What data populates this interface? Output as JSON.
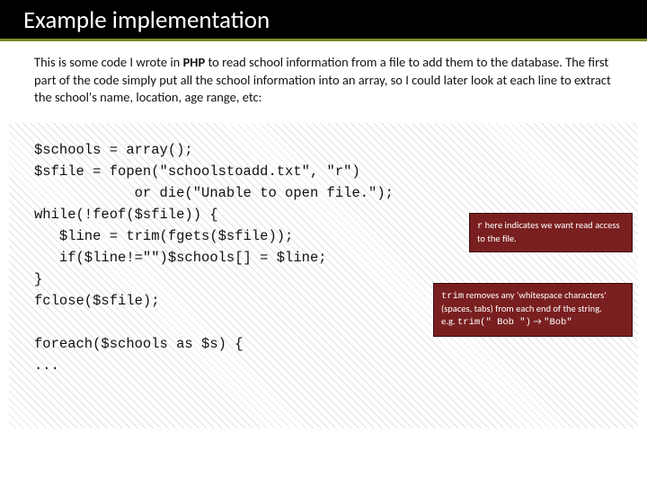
{
  "title": "Example implementation",
  "intro_parts": {
    "before": "This is some code I wrote in ",
    "bold": "PHP",
    "after": " to read school information from a file to add them to the database. The first part of the code simply put all the school information into an array, so I could later look at each line to extract the school's name, location, age range, etc:"
  },
  "code": "$schools = array();\n$sfile = fopen(\"schoolstoadd.txt\", \"r\")\n            or die(\"Unable to open file.\");\nwhile(!feof($sfile)) {\n   $line = trim(fgets($sfile));\n   if($line!=\"\")$schools[] = $line;\n}\nfclose($sfile);\n\nforeach($schools as $s) {\n...",
  "callout1": {
    "code": "r",
    "text": " here indicates we want read access to the file."
  },
  "callout2": {
    "code1": "trim",
    "text1": " removes any 'whitespace characters' (spaces, tabs) from each end of the string.",
    "eg_label": "e.g. ",
    "eg_code": "trim(\"   Bob \")",
    "arrow": " → ",
    "eg_result": "\"Bob\""
  }
}
